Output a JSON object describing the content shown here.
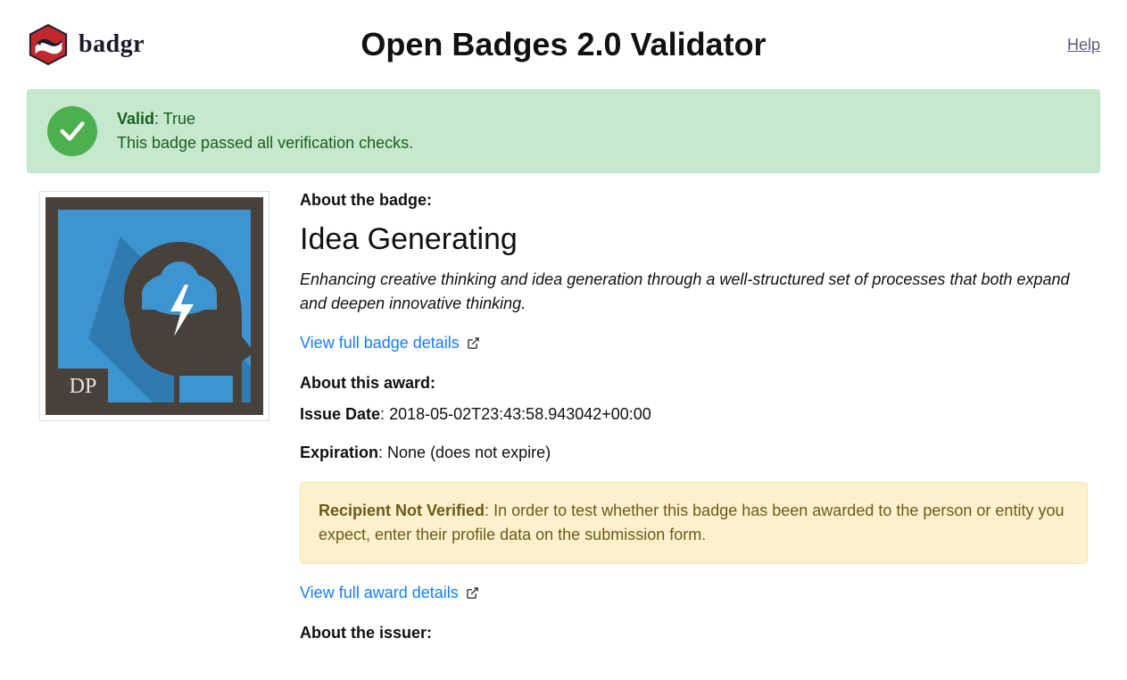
{
  "header": {
    "logo_text": "badgr",
    "title": "Open Badges 2.0 Validator",
    "help_label": "Help"
  },
  "valid_alert": {
    "label": "Valid",
    "value": "True",
    "message": "This badge passed all verification checks."
  },
  "badge_image": {
    "dp_label": "DP"
  },
  "sections": {
    "about_badge": "About the badge:",
    "about_award": "About this award:",
    "about_issuer": "About the issuer:"
  },
  "badge": {
    "name": "Idea Generating",
    "description": "Enhancing creative thinking and idea generation through a well-structured set of processes that both expand and deepen innovative thinking.",
    "details_link": "View full badge details"
  },
  "award": {
    "issue_date_label": "Issue Date",
    "issue_date_value": "2018-05-02T23:43:58.943042+00:00",
    "expiration_label": "Expiration",
    "expiration_value": "None (does not expire)",
    "details_link": "View full award details"
  },
  "recipient_warning": {
    "label": "Recipient Not Verified",
    "message": "In order to test whether this badge has been awarded to the person or entity you expect, enter their profile data on the submission form."
  }
}
